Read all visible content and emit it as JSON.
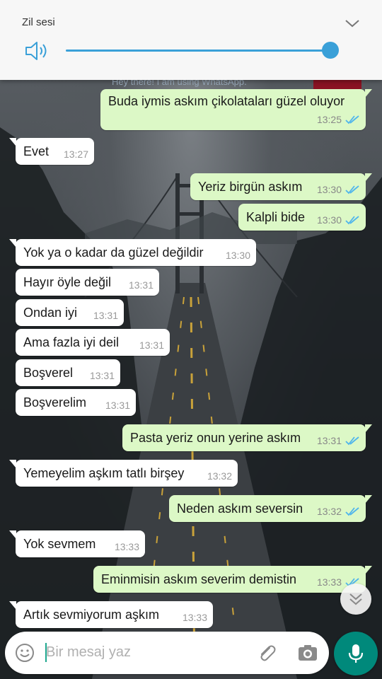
{
  "volume": {
    "title": "Zil sesi",
    "level_percent": 100
  },
  "peek": {
    "status_text": "Hey there! I am using WhatsApp."
  },
  "messages": [
    {
      "dir": "out",
      "text": "Buda iymis askım çikolataları güzel oluyor",
      "time": "13:25",
      "read": true
    },
    {
      "dir": "in",
      "text": "Evet",
      "time": "13:27"
    },
    {
      "dir": "out",
      "text": "Yeriz birgün askım",
      "time": "13:30",
      "read": true
    },
    {
      "dir": "out",
      "text": "Kalpli bide",
      "time": "13:30",
      "read": true
    },
    {
      "dir": "in",
      "text": "Yok ya o kadar da güzel değildir",
      "time": "13:30"
    },
    {
      "dir": "in",
      "text": "Hayır öyle değil",
      "time": "13:31"
    },
    {
      "dir": "in",
      "text": "Ondan iyi",
      "time": "13:31"
    },
    {
      "dir": "in",
      "text": "Ama fazla iyi deil",
      "time": "13:31"
    },
    {
      "dir": "in",
      "text": "Boşverel",
      "time": "13:31"
    },
    {
      "dir": "in",
      "text": "Boşverelim",
      "time": "13:31"
    },
    {
      "dir": "out",
      "text": "Pasta yeriz onun yerine askım",
      "time": "13:31",
      "read": true
    },
    {
      "dir": "in",
      "text": "Yemeyelim aşkım tatlı birşey",
      "time": "13:32"
    },
    {
      "dir": "out",
      "text": "Neden askım seversin",
      "time": "13:32",
      "read": true
    },
    {
      "dir": "in",
      "text": "Yok sevmem",
      "time": "13:33"
    },
    {
      "dir": "out",
      "text": "Eminmisin askım severim demistin",
      "time": "13:33",
      "read": true
    },
    {
      "dir": "in",
      "text": "Artık sevmiyorum aşkım",
      "time": "13:33"
    }
  ],
  "composer": {
    "placeholder": "Bir mesaj yaz"
  },
  "colors": {
    "accent": "#3aa0d8",
    "outgoing_bubble": "#dcf8c6",
    "incoming_bubble": "#ffffff",
    "read_tick": "#4fb5ec",
    "mic_button": "#00897b"
  },
  "icons": {
    "volume": "speaker-icon",
    "expand": "chevron-down-icon",
    "emoji": "emoji-icon",
    "attach": "paperclip-icon",
    "camera": "camera-icon",
    "mic": "microphone-icon",
    "scroll": "double-chevron-down-icon"
  }
}
